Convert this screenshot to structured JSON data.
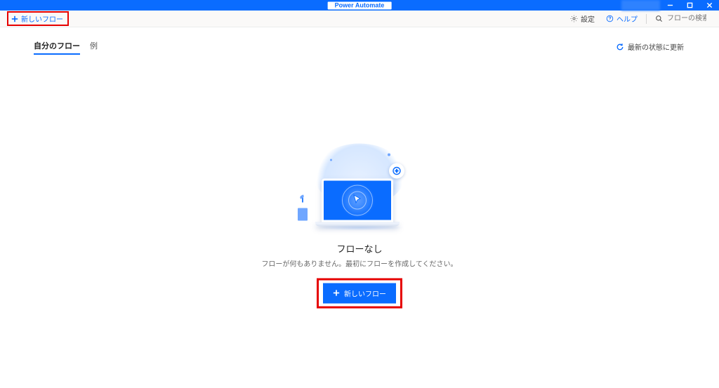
{
  "titlebar": {
    "title": "Power Automate"
  },
  "cmdbar": {
    "new_flow": "新しいフロー",
    "settings": "設定",
    "help": "ヘルプ",
    "search_placeholder": "フローの検索"
  },
  "tabs": {
    "my_flows": "自分のフロー",
    "examples": "例"
  },
  "refresh": {
    "label": "最新の状態に更新"
  },
  "empty": {
    "title": "フローなし",
    "subtitle": "フローが何もありません。最初にフローを作成してください。",
    "button": "新しいフロー"
  }
}
